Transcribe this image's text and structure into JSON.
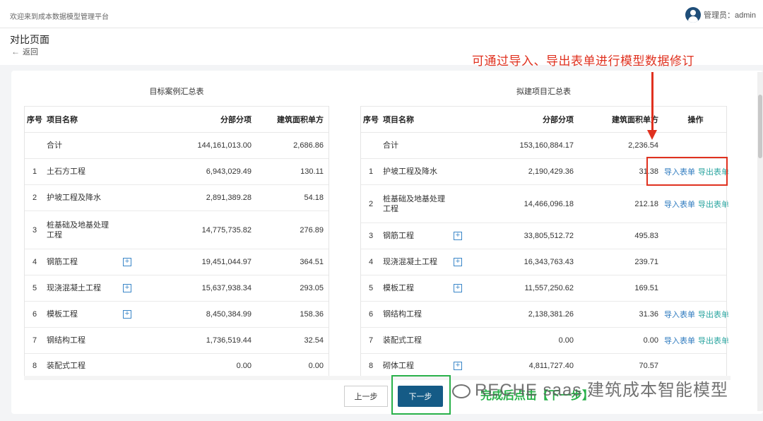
{
  "header": {
    "welcome": "欢迎来到成本数据模型管理平台",
    "user_label": "管理员：admin"
  },
  "page": {
    "title": "对比页面",
    "back_label": "返回"
  },
  "annotation": {
    "hint": "可通过导入、导出表单进行模型数据修订"
  },
  "left_table": {
    "caption": "目标案例汇总表",
    "columns": [
      "序号",
      "项目名称",
      "分部分项",
      "建筑面积单方"
    ],
    "total": {
      "name": "合计",
      "value": "144,161,013.00",
      "unit": "2,686.86"
    },
    "rows": [
      {
        "no": "1",
        "name": "土石方工程",
        "value": "6,943,029.49",
        "unit": "130.11",
        "expand": false
      },
      {
        "no": "2",
        "name": "护坡工程及降水",
        "value": "2,891,389.28",
        "unit": "54.18",
        "expand": false
      },
      {
        "no": "3",
        "name": "桩基础及地基处理工程",
        "value": "14,775,735.82",
        "unit": "276.89",
        "expand": false
      },
      {
        "no": "4",
        "name": "钢筋工程",
        "value": "19,451,044.97",
        "unit": "364.51",
        "expand": true
      },
      {
        "no": "5",
        "name": "现浇混凝土工程",
        "value": "15,637,938.34",
        "unit": "293.05",
        "expand": true
      },
      {
        "no": "6",
        "name": "模板工程",
        "value": "8,450,384.99",
        "unit": "158.36",
        "expand": true
      },
      {
        "no": "7",
        "name": "钢结构工程",
        "value": "1,736,519.44",
        "unit": "32.54",
        "expand": false
      },
      {
        "no": "8",
        "name": "装配式工程",
        "value": "0.00",
        "unit": "0.00",
        "expand": false
      }
    ]
  },
  "right_table": {
    "caption": "拟建项目汇总表",
    "columns": [
      "序号",
      "项目名称",
      "分部分项",
      "建筑面积单方",
      "操作"
    ],
    "total": {
      "name": "合计",
      "value": "153,160,884.17",
      "unit": "2,236.54"
    },
    "rows": [
      {
        "no": "1",
        "name": "护坡工程及降水",
        "value": "2,190,429.36",
        "unit": "31.38",
        "expand": false,
        "ops": true
      },
      {
        "no": "2",
        "name": "桩基础及地基处理工程",
        "value": "14,466,096.18",
        "unit": "212.18",
        "expand": false,
        "ops": true
      },
      {
        "no": "3",
        "name": "钢筋工程",
        "value": "33,805,512.72",
        "unit": "495.83",
        "expand": true,
        "ops": false
      },
      {
        "no": "4",
        "name": "现浇混凝土工程",
        "value": "16,343,763.43",
        "unit": "239.71",
        "expand": true,
        "ops": false
      },
      {
        "no": "5",
        "name": "模板工程",
        "value": "11,557,250.62",
        "unit": "169.51",
        "expand": true,
        "ops": false
      },
      {
        "no": "6",
        "name": "钢结构工程",
        "value": "2,138,381.26",
        "unit": "31.36",
        "expand": false,
        "ops": true
      },
      {
        "no": "7",
        "name": "装配式工程",
        "value": "0.00",
        "unit": "0.00",
        "expand": false,
        "ops": true
      },
      {
        "no": "8",
        "name": "砌体工程",
        "value": "4,811,727.40",
        "unit": "70.57",
        "expand": true,
        "ops": false
      }
    ],
    "op_import": "导入表单",
    "op_export": "导出表单"
  },
  "footer": {
    "prev_label": "上一步",
    "next_label": "下一步",
    "done_hint": "完成后点击【下一步】",
    "watermark": "RECHE saas 建筑成本智能模型"
  },
  "colors": {
    "primary": "#155b86",
    "highlight_red": "#e0311f",
    "highlight_green": "#29b14a"
  }
}
